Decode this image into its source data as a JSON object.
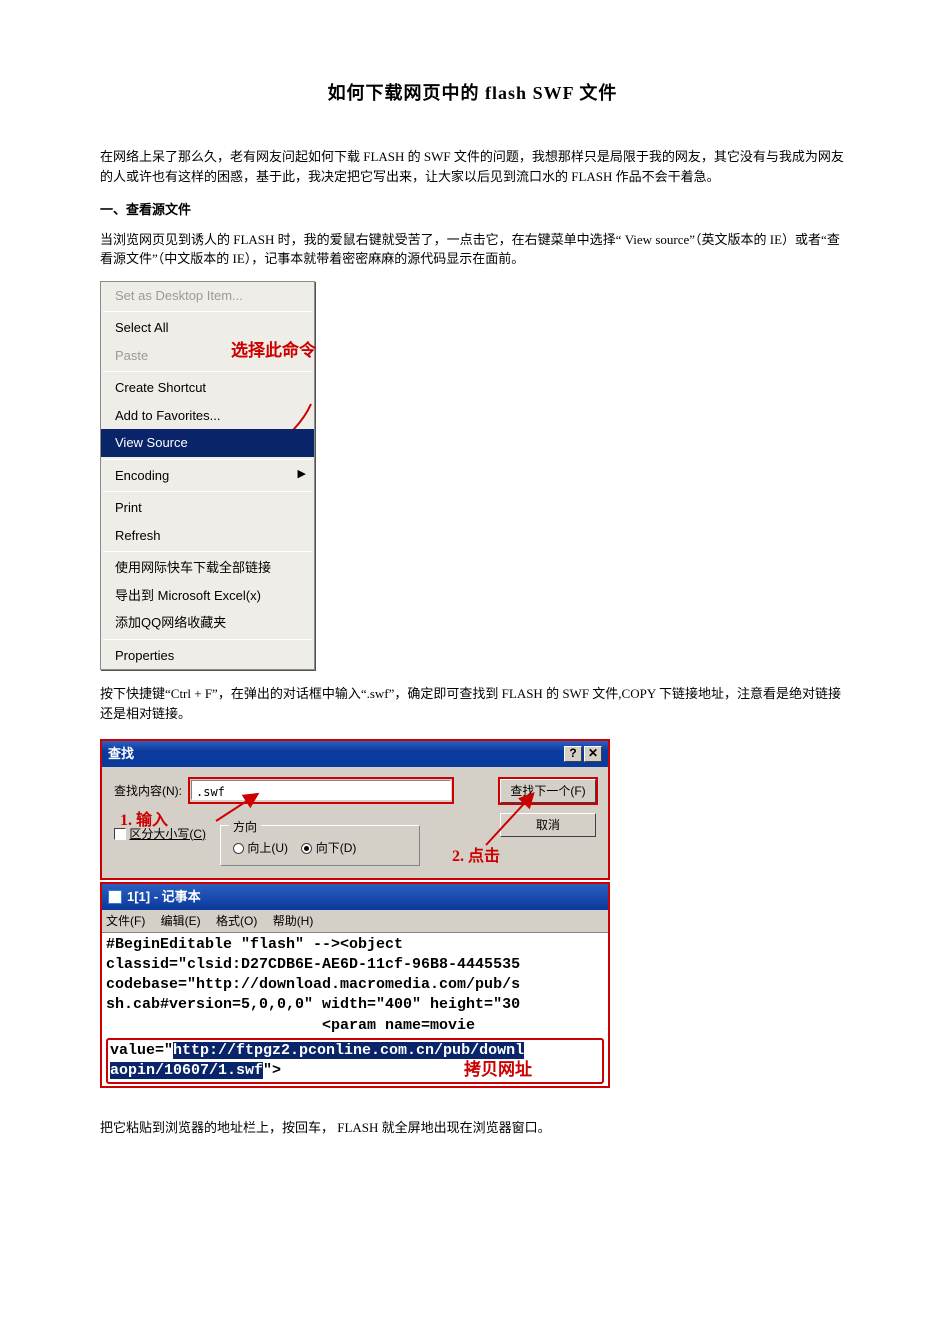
{
  "title": "如何下载网页中的 flash  SWF 文件",
  "para1": "在网络上呆了那么久，老有网友问起如何下载 FLASH 的 SWF 文件的问题，我想那样只是局限于我的网友，其它没有与我成为网友的人或许也有这样的困惑，基于此，我决定把它写出来，让大家以后见到流口水的 FLASH 作品不会干着急。",
  "section1": "一、查看源文件",
  "para2": "    当浏览网页见到诱人的 FLASH 时，我的爱鼠右键就受苦了，一点击它，在右键菜单中选择“ View source”（英文版本的 IE）或者“查看源文件”（中文版本的 IE），记事本就带着密密麻麻的源代码显示在面前。",
  "ctx": {
    "setDesktop": "Set as Desktop Item...",
    "selectAll": "Select All",
    "paste": "Paste",
    "createShortcut": "Create Shortcut",
    "addFav": "Add to Favorites...",
    "viewSource": "View Source",
    "encoding": "Encoding",
    "print": "Print",
    "refresh": "Refresh",
    "flashget": "使用网际快车下载全部链接",
    "exportExcel": "导出到 Microsoft Excel(x)",
    "addQQ": "添加QQ网络收藏夹",
    "properties": "Properties",
    "annot": "选择此命令"
  },
  "para3": "    按下快捷键“Ctrl + F”，在弹出的对话框中输入“.swf”，确定即可查找到 FLASH 的 SWF 文件,COPY 下链接地址，注意看是绝对链接还是相对链接。",
  "find": {
    "title": "查找",
    "label": "查找内容(N):",
    "input": ".swf",
    "findNext": "查找下一个(F)",
    "cancel": "取消",
    "matchCase": "区分大小写(C)",
    "direction": "方向",
    "up": "向上(U)",
    "down": "向下(D)",
    "annot1": "1. 输入",
    "annot2": "2. 点击"
  },
  "notepad": {
    "title": "1[1] - 记事本",
    "m_file": "文件(F)",
    "m_edit": "编辑(E)",
    "m_format": "格式(O)",
    "m_help": "帮助(H)",
    "line1": "#BeginEditable \"flash\" --><object",
    "line2": "classid=\"clsid:D27CDB6E-AE6D-11cf-96B8-4445535",
    "line3": "codebase=\"http://download.macromedia.com/pub/s",
    "line4": "sh.cab#version=5,0,0,0\" width=\"400\" height=\"30",
    "line5": "                        <param name=movie",
    "hl_prefix": "value=\"",
    "hl_url": "http://ftpgz2.pconline.com.cn/pub/downl",
    "hl_url2": "aopin/10607/1.swf",
    "hl_suffix": "\">",
    "annot": "拷贝网址"
  },
  "para4": "    把它粘贴到浏览器的地址栏上，按回车， FLASH 就全屏地出现在浏览器窗口。"
}
